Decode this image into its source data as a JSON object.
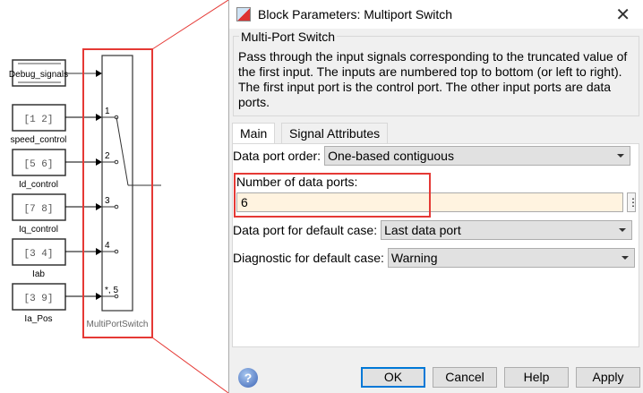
{
  "diagram": {
    "debug_block": "Debug_signals",
    "constants": [
      {
        "value": "[1 2]",
        "label": "speed_control"
      },
      {
        "value": "[5 6]",
        "label": "Id_control"
      },
      {
        "value": "[7 8]",
        "label": "Iq_control"
      },
      {
        "value": "[3 4]",
        "label": "Iab"
      },
      {
        "value": "[3 9]",
        "label": "Ia_Pos"
      }
    ],
    "switch_ports": [
      "1",
      "2",
      "3",
      "4",
      "*, 5"
    ],
    "switch_label": "MultiPortSwitch",
    "highlight_color": "#e53935"
  },
  "dialog": {
    "title": "Block Parameters: Multiport Switch",
    "group_title": "Multi-Port Switch",
    "description": "Pass through the input signals corresponding to the truncated value of the first input. The inputs are numbered top to bottom (or left to right). The first input port is the control port. The other input ports are data ports.",
    "tabs": [
      "Main",
      "Signal Attributes"
    ],
    "data_port_order_label": "Data port order:",
    "data_port_order_value": "One-based contiguous",
    "num_ports_label": "Number of data ports:",
    "num_ports_value": "6",
    "default_case_label": "Data port for default case:",
    "default_case_value": "Last data port",
    "diagnostic_label": "Diagnostic for default case:",
    "diagnostic_value": "Warning",
    "buttons": {
      "ok": "OK",
      "cancel": "Cancel",
      "help": "Help",
      "apply": "Apply"
    },
    "help_icon": "?"
  }
}
